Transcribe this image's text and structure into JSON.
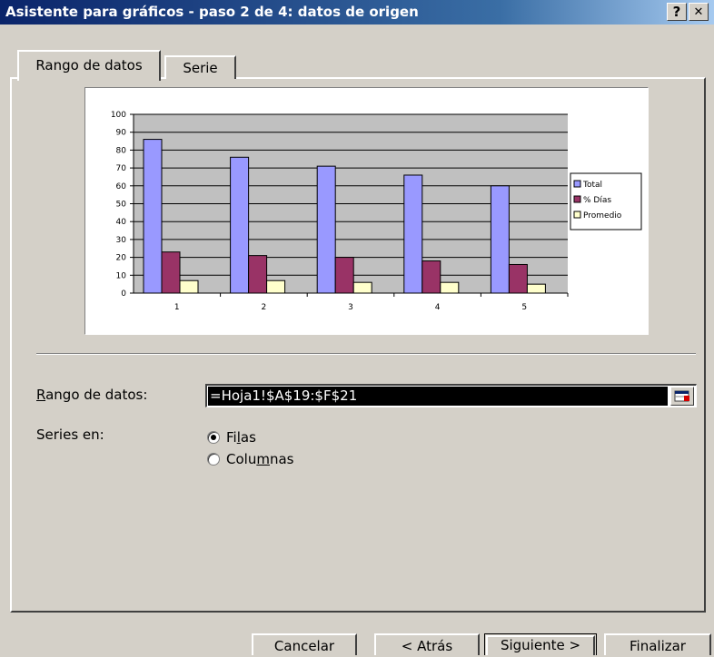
{
  "window": {
    "title": "Asistente para gráficos - paso 2 de 4: datos de origen",
    "help_label": "?",
    "close_label": "✕"
  },
  "tabs": [
    {
      "label": "Rango de datos",
      "active": true
    },
    {
      "label": "Serie",
      "active": false
    }
  ],
  "form": {
    "range_label_prefix": "R",
    "range_label_rest": "ango de datos:",
    "range_value": "=Hoja1!$A$19:$F$21",
    "series_label": "Series en:",
    "option_rows_pre": "Fi",
    "option_rows_u": "l",
    "option_rows_post": "as",
    "option_cols_pre": "Colu",
    "option_cols_u": "m",
    "option_cols_post": "nas",
    "selected": "rows"
  },
  "buttons": {
    "cancel": "Cancelar",
    "back": "< Atrás",
    "next": "Siguiente >",
    "finish": "Finalizar"
  },
  "chart_data": {
    "type": "bar",
    "categories": [
      "1",
      "2",
      "3",
      "4",
      "5"
    ],
    "series": [
      {
        "name": "Total",
        "values": [
          86,
          76,
          71,
          66,
          60
        ],
        "color": "#9999ff"
      },
      {
        "name": "% Días",
        "values": [
          23,
          21,
          20,
          18,
          16
        ],
        "color": "#993366"
      },
      {
        "name": "Promedio",
        "values": [
          7,
          7,
          6,
          6,
          5
        ],
        "color": "#ffffcc"
      }
    ],
    "ylim": [
      0,
      100
    ],
    "yticks": [
      0,
      10,
      20,
      30,
      40,
      50,
      60,
      70,
      80,
      90,
      100
    ],
    "plot_background": "#c0c0c0",
    "grid": true,
    "legend": "right"
  }
}
